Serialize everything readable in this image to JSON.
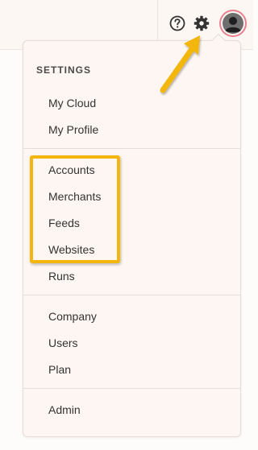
{
  "topbar": {
    "help_icon": "question-circle-icon",
    "settings_icon": "gear-icon",
    "avatar_icon": "user-avatar-icon"
  },
  "settings_menu": {
    "section_title": "SETTINGS",
    "groups": [
      {
        "items": [
          "My Cloud",
          "My Profile"
        ]
      },
      {
        "items": [
          "Accounts",
          "Merchants",
          "Feeds",
          "Websites",
          "Runs"
        ]
      },
      {
        "items": [
          "Company",
          "Users",
          "Plan"
        ]
      },
      {
        "items": [
          "Admin"
        ]
      }
    ]
  },
  "annotation": {
    "color": "#f2b60f",
    "highlighted_items": [
      "Accounts",
      "Merchants",
      "Feeds",
      "Websites"
    ]
  },
  "colors": {
    "panel_bg": "#fdf6f2",
    "avatar_ring": "#e8808f"
  }
}
